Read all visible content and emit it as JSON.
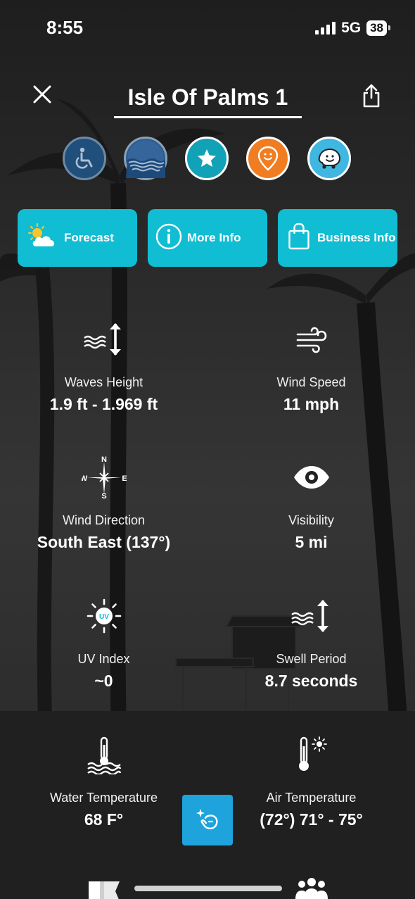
{
  "status_bar": {
    "time": "8:55",
    "network": "5G",
    "battery": "38"
  },
  "header": {
    "title": "Isle Of Palms 1"
  },
  "badges": [
    {
      "icon": "wheelchair-icon",
      "color": "#1f4f7a"
    },
    {
      "icon": "waves-icon",
      "color": "#2c5b8c"
    },
    {
      "icon": "star-icon",
      "color": "#11a2b8"
    },
    {
      "icon": "map-pin-smile-icon",
      "color": "#f07d22"
    },
    {
      "icon": "waze-icon",
      "color": "#3fb7e0"
    }
  ],
  "actions": {
    "forecast_label": "Forecast",
    "more_info_label": "More Info",
    "business_info_label": "Business Info",
    "accent": "#10bdd3"
  },
  "metrics": {
    "waves_height": {
      "label": "Waves Height",
      "value": "1.9 ft - 1.969 ft"
    },
    "wind_speed": {
      "label": "Wind Speed",
      "value": "11 mph"
    },
    "wind_direction": {
      "label": "Wind Direction",
      "value": "South East (137°)"
    },
    "visibility": {
      "label": "Visibility",
      "value": "5 mi"
    },
    "uv_index": {
      "label": "UV Index",
      "value": "~0"
    },
    "swell_period": {
      "label": "Swell Period",
      "value": "8.7 seconds"
    },
    "water_temperature": {
      "label": "Water Temperature",
      "value": "68 F°"
    },
    "air_temperature": {
      "label": "Air Temperature",
      "value": "(72°) 71° - 75°"
    }
  },
  "compass": {
    "n": "N",
    "e": "E",
    "s": "S",
    "w": "W"
  },
  "uv_badge": "UV",
  "fab": {
    "icon": "sparkle-hand-icon",
    "color": "#1ea3dc"
  }
}
